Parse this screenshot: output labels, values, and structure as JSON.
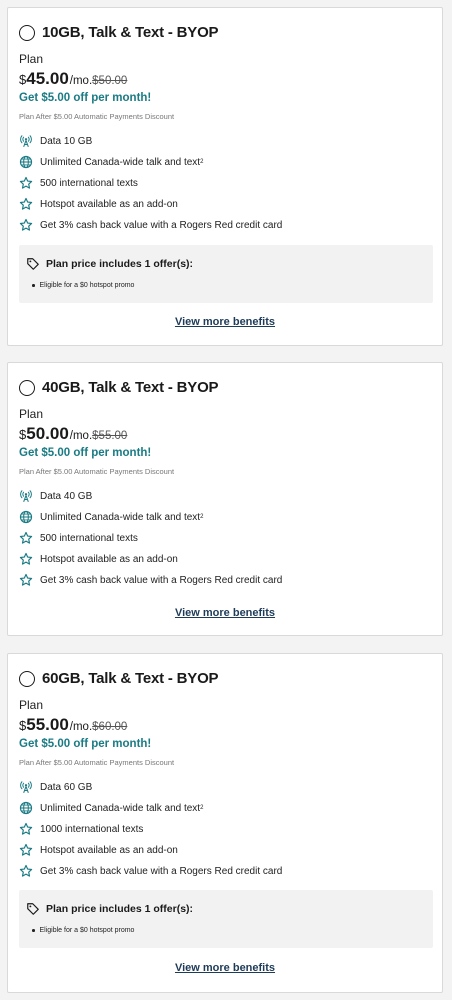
{
  "colors": {
    "accent": "#1a7b84",
    "link": "#1e3b58",
    "offer_bg": "#f2f2f2"
  },
  "plans": [
    {
      "title": "10GB, Talk & Text - BYOP",
      "plan_label": "Plan",
      "currency": "$",
      "price": "45.00",
      "per": "/mo.",
      "old_price": "$50.00",
      "promo": "Get $5.00 off per month!",
      "discount_note": "Plan After $5.00 Automatic Payments Discount",
      "features": [
        {
          "icon": "signal-tower-icon",
          "text": "Data 10 GB",
          "sup": ""
        },
        {
          "icon": "globe-icon",
          "text": "Unlimited Canada-wide talk and text",
          "sup": "2"
        },
        {
          "icon": "star-icon",
          "text": "500 international texts",
          "sup": ""
        },
        {
          "icon": "star-icon",
          "text": "Hotspot available as an add-on",
          "sup": ""
        },
        {
          "icon": "star-icon",
          "text": "Get 3% cash back value with a Rogers Red credit card",
          "sup": ""
        }
      ],
      "offer_title": "Plan price includes 1 offer(s):",
      "offer_item": "Eligible for a $0 hotspot promo",
      "link": "View more benefits"
    },
    {
      "title": "40GB, Talk & Text - BYOP",
      "plan_label": "Plan",
      "currency": "$",
      "price": "50.00",
      "per": "/mo.",
      "old_price": "$55.00",
      "promo": "Get $5.00 off per month!",
      "discount_note": "Plan After $5.00 Automatic Payments Discount",
      "features": [
        {
          "icon": "signal-tower-icon",
          "text": "Data 40 GB",
          "sup": ""
        },
        {
          "icon": "globe-icon",
          "text": "Unlimited Canada-wide talk and text",
          "sup": "2"
        },
        {
          "icon": "star-icon",
          "text": "500 international texts",
          "sup": ""
        },
        {
          "icon": "star-icon",
          "text": "Hotspot available as an add-on",
          "sup": ""
        },
        {
          "icon": "star-icon",
          "text": "Get 3% cash back value with a Rogers Red credit card",
          "sup": ""
        }
      ],
      "link": "View more benefits"
    },
    {
      "title": "60GB, Talk & Text - BYOP",
      "plan_label": "Plan",
      "currency": "$",
      "price": "55.00",
      "per": "/mo.",
      "old_price": "$60.00",
      "promo": "Get $5.00 off per month!",
      "discount_note": "Plan After $5.00 Automatic Payments Discount",
      "features": [
        {
          "icon": "signal-tower-icon",
          "text": "Data 60 GB",
          "sup": ""
        },
        {
          "icon": "globe-icon",
          "text": "Unlimited Canada-wide talk and text",
          "sup": "2"
        },
        {
          "icon": "star-icon",
          "text": "1000 international texts",
          "sup": ""
        },
        {
          "icon": "star-icon",
          "text": "Hotspot available as an add-on",
          "sup": ""
        },
        {
          "icon": "star-icon",
          "text": "Get 3% cash back value with a Rogers Red credit card",
          "sup": ""
        }
      ],
      "offer_title": "Plan price includes 1 offer(s):",
      "offer_item": "Eligible for a $0 hotspot promo",
      "link": "View more benefits"
    }
  ]
}
